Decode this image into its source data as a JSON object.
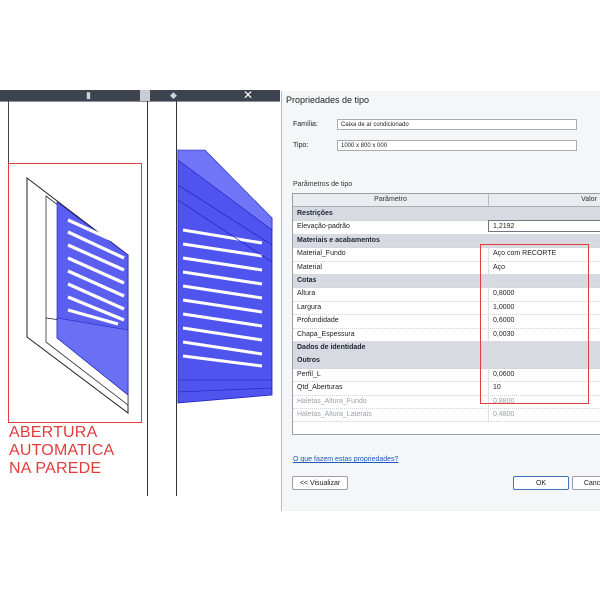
{
  "annotation": {
    "text": "ABERTURA\nAUTOMATICA\nNA PAREDE",
    "color": "#e23c3c"
  },
  "dialog": {
    "title": "Propriedades de tipo",
    "family_label": "Família:",
    "family_value": "Caixa de ar condicionado",
    "type_label": "Tipo:",
    "type_value": "1000 x 800 x 000",
    "params_label": "Parâmetros de tipo",
    "col_param": "Parâmetro",
    "col_value": "Valor",
    "rows": [
      {
        "kind": "section",
        "key": "Restrições",
        "value": ""
      },
      {
        "kind": "edit",
        "key": "Elevação-padrão",
        "value": "1,2192"
      },
      {
        "kind": "section",
        "key": "Materiais e acabamentos",
        "value": ""
      },
      {
        "kind": "row",
        "key": "Material_Fundo",
        "value": "Aço com RECORTE"
      },
      {
        "kind": "row",
        "key": "Material",
        "value": "Aço"
      },
      {
        "kind": "section",
        "key": "Cotas",
        "value": ""
      },
      {
        "kind": "row",
        "key": "Altura",
        "value": "0,8000"
      },
      {
        "kind": "row",
        "key": "Largura",
        "value": "1,0000"
      },
      {
        "kind": "row",
        "key": "Profundidade",
        "value": "0,6000"
      },
      {
        "kind": "row",
        "key": "Chapa_Espessura",
        "value": "0,0030"
      },
      {
        "kind": "section",
        "key": "Dados de identidade",
        "value": ""
      },
      {
        "kind": "section",
        "key": "Outros",
        "value": ""
      },
      {
        "kind": "row",
        "key": "Perfil_L",
        "value": "0,0600"
      },
      {
        "kind": "row",
        "key": "Qtd_Aberturas",
        "value": "10"
      },
      {
        "kind": "disabled",
        "key": "Haletas_Altura_Fundo",
        "value": "0,8800"
      },
      {
        "kind": "disabled",
        "key": "Haletas_Altura_Laterais",
        "value": "0,4800"
      }
    ],
    "help_link": "O que fazem estas propriedades?",
    "preview_button": "<< Visualizar",
    "ok_button": "OK",
    "cancel_button": "Canc"
  },
  "colors": {
    "accent_blue": "#5a5ff0",
    "red_annotation": "#e23c3c"
  }
}
